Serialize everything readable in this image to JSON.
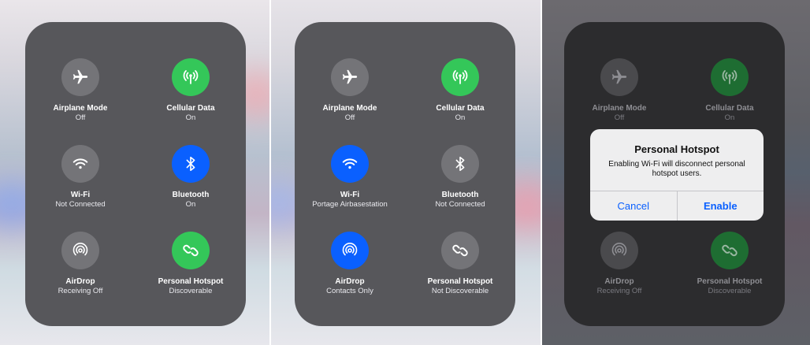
{
  "panels": [
    {
      "tiles": [
        {
          "name": "Airplane Mode",
          "state": "Off",
          "icon": "airplane-icon",
          "color": "gray"
        },
        {
          "name": "Cellular Data",
          "state": "On",
          "icon": "cellular-icon",
          "color": "green"
        },
        {
          "name": "Wi-Fi",
          "state": "Not Connected",
          "icon": "wifi-icon",
          "color": "gray"
        },
        {
          "name": "Bluetooth",
          "state": "On",
          "icon": "bluetooth-icon",
          "color": "blue"
        },
        {
          "name": "AirDrop",
          "state": "Receiving Off",
          "icon": "airdrop-icon",
          "color": "gray"
        },
        {
          "name": "Personal Hotspot",
          "state": "Discoverable",
          "icon": "hotspot-icon",
          "color": "green"
        }
      ]
    },
    {
      "tiles": [
        {
          "name": "Airplane Mode",
          "state": "Off",
          "icon": "airplane-icon",
          "color": "gray"
        },
        {
          "name": "Cellular Data",
          "state": "On",
          "icon": "cellular-icon",
          "color": "green"
        },
        {
          "name": "Wi-Fi",
          "state": "Portage Airbasestation",
          "icon": "wifi-icon",
          "color": "blue"
        },
        {
          "name": "Bluetooth",
          "state": "Not Connected",
          "icon": "bluetooth-icon",
          "color": "gray"
        },
        {
          "name": "AirDrop",
          "state": "Contacts Only",
          "icon": "airdrop-icon",
          "color": "blue"
        },
        {
          "name": "Personal Hotspot",
          "state": "Not Discoverable",
          "icon": "hotspot-icon",
          "color": "gray"
        }
      ]
    },
    {
      "tiles": [
        {
          "name": "Airplane Mode",
          "state": "Off",
          "icon": "airplane-icon",
          "color": "gray"
        },
        {
          "name": "Cellular Data",
          "state": "On",
          "icon": "cellular-icon",
          "color": "green"
        },
        {
          "name": "AirDrop",
          "state": "Receiving Off",
          "icon": "airdrop-icon",
          "color": "gray"
        },
        {
          "name": "Personal Hotspot",
          "state": "Discoverable",
          "icon": "hotspot-icon",
          "color": "green"
        }
      ],
      "alert": {
        "title": "Personal Hotspot",
        "message": "Enabling Wi-Fi will disconnect personal hotspot users.",
        "cancel_label": "Cancel",
        "enable_label": "Enable"
      }
    }
  ],
  "colors": {
    "green": "#34c759",
    "blue": "#0a60ff",
    "gray": "#747478",
    "accent": "#0a60ff"
  }
}
